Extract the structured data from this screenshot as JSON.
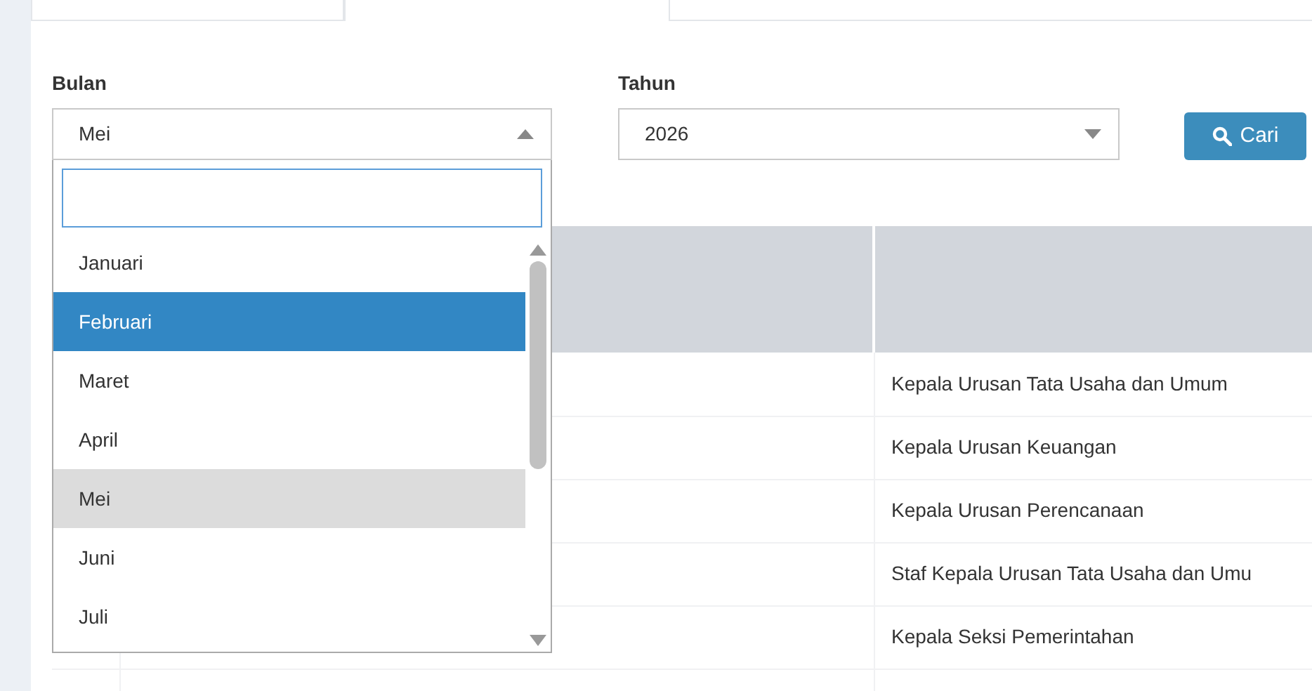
{
  "filters": [
    {
      "label": "Bulan",
      "value": "Mei",
      "open": true
    },
    {
      "label": "Tahun",
      "value": "2026",
      "open": false
    }
  ],
  "month_dropdown": {
    "options": [
      {
        "label": "Januari",
        "hovered": false,
        "selected": false
      },
      {
        "label": "Februari",
        "hovered": true,
        "selected": false
      },
      {
        "label": "Maret",
        "hovered": false,
        "selected": false
      },
      {
        "label": "April",
        "hovered": false,
        "selected": false
      },
      {
        "label": "Mei",
        "hovered": false,
        "selected": true
      },
      {
        "label": "Juni",
        "hovered": false,
        "selected": false
      },
      {
        "label": "Juli",
        "hovered": false,
        "selected": false
      }
    ]
  },
  "search_button": "Cari",
  "table": {
    "rows": [
      {
        "column_3": "Kepala Urusan Tata Usaha dan Umum"
      },
      {
        "column_3": "Kepala Urusan Keuangan"
      },
      {
        "column_3": "Kepala Urusan Perencanaan"
      },
      {
        "column_3": "Staf Kepala Urusan Tata Usaha dan Umu"
      },
      {
        "column_3": "Kepala Seksi Pemerintahan"
      }
    ]
  }
}
